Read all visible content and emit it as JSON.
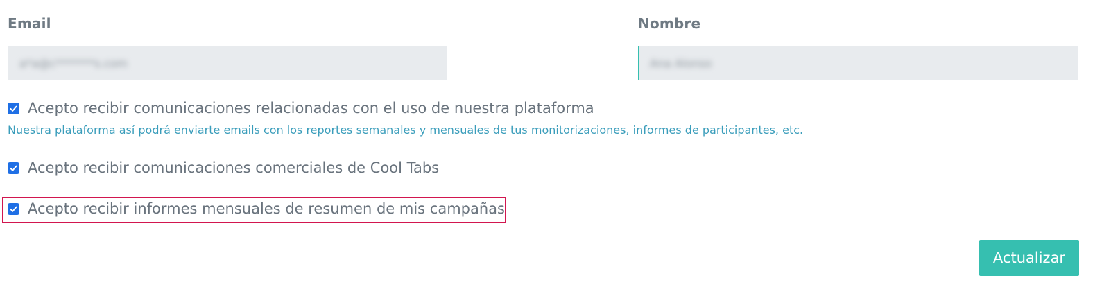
{
  "form": {
    "email": {
      "label": "Email",
      "value": "a*a@c*******s.com"
    },
    "name": {
      "label": "Nombre",
      "value": "Ana Alonso"
    },
    "checkboxes": [
      {
        "label": "Acepto recibir comunicaciones relacionadas con el uso de nuestra plataforma",
        "checked": true,
        "help": "Nuestra plataforma así podrá enviarte emails con los reportes semanales y mensuales de tus monitorizaciones, informes de participantes, etc."
      },
      {
        "label": "Acepto recibir comunicaciones comerciales de Cool Tabs",
        "checked": true
      },
      {
        "label": "Acepto recibir informes mensuales de resumen de mis campañas",
        "checked": true,
        "highlighted": true
      }
    ],
    "submit_label": "Actualizar"
  },
  "colors": {
    "accent": "#36bfb0",
    "checkbox": "#1f6fe5",
    "help_text": "#3a9dbb",
    "highlight": "#d2164f",
    "input_bg": "#e8ebee"
  },
  "icons": {
    "checkbox_check": "check-icon"
  }
}
